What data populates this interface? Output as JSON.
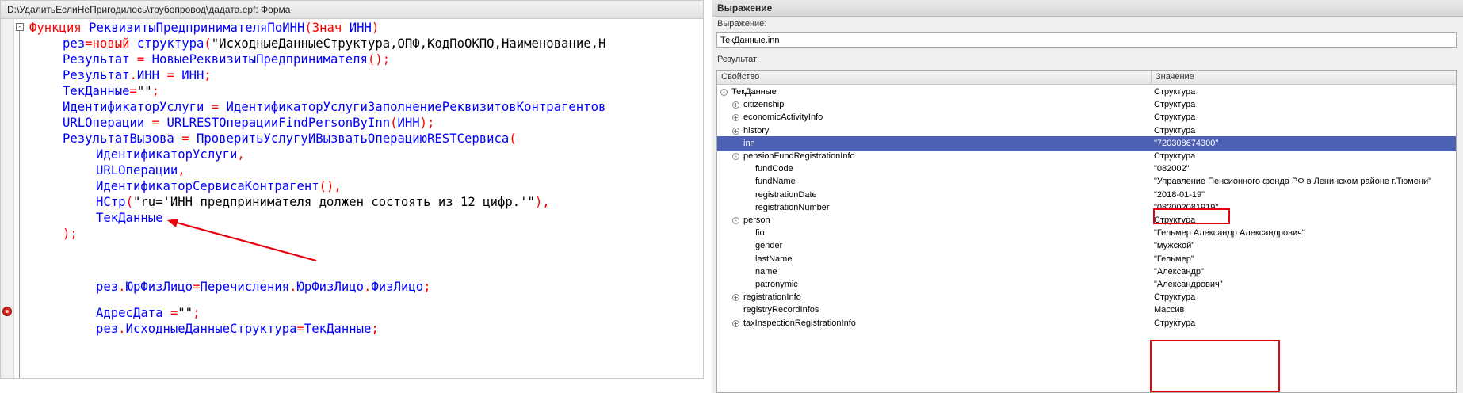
{
  "editor": {
    "title": "D:\\УдалитьЕслиНеПригодилось\\трубопровод\\дадата.epf: Форма",
    "fold_glyph": "-",
    "lines": [
      [
        [
          "kw",
          "Функция "
        ],
        [
          "id",
          "РеквизитыПредпринимателяПоИНН"
        ],
        [
          "op",
          "("
        ],
        [
          "kw",
          "Знач "
        ],
        [
          "id",
          "ИНН"
        ],
        [
          "op",
          ")"
        ]
      ],
      [
        [
          "id",
          "рез"
        ],
        [
          "op",
          "="
        ],
        [
          "kw",
          "новый "
        ],
        [
          "id",
          "структура"
        ],
        [
          "op",
          "("
        ],
        [
          "str",
          "\"ИсходныеДанныеСтруктура,ОПФ,КодПоОКПО,Наименование,Н"
        ]
      ],
      [
        [
          "id",
          "Результат "
        ],
        [
          "op",
          "= "
        ],
        [
          "id",
          "НовыеРеквизитыПредпринимателя"
        ],
        [
          "op",
          "();"
        ]
      ],
      [
        [
          "id",
          "Результат"
        ],
        [
          "op",
          "."
        ],
        [
          "id",
          "ИНН "
        ],
        [
          "op",
          "= "
        ],
        [
          "id",
          "ИНН"
        ],
        [
          "op",
          ";"
        ]
      ],
      [
        [
          "id",
          "ТекДанные"
        ],
        [
          "op",
          "="
        ],
        [
          "str",
          "\"\""
        ],
        [
          "op",
          ";"
        ]
      ],
      [
        [
          "id",
          "ИдентификаторУслуги "
        ],
        [
          "op",
          "= "
        ],
        [
          "id",
          "ИдентификаторУслугиЗаполнениеРеквизитовКонтрагентов"
        ]
      ],
      [
        [
          "id",
          "URLОперации "
        ],
        [
          "op",
          "= "
        ],
        [
          "id",
          "URLRESTОперацииFindPersonByInn"
        ],
        [
          "op",
          "("
        ],
        [
          "id",
          "ИНН"
        ],
        [
          "op",
          ");"
        ]
      ],
      [
        [
          "id",
          "РезультатВызова "
        ],
        [
          "op",
          "= "
        ],
        [
          "id",
          "ПроверитьУслугуИВызватьОперациюRESTСервиса"
        ],
        [
          "op",
          "("
        ]
      ],
      [
        [
          "id",
          "ИдентификаторУслуги"
        ],
        [
          "op",
          ","
        ]
      ],
      [
        [
          "id",
          "URLОперации"
        ],
        [
          "op",
          ","
        ]
      ],
      [
        [
          "id",
          "ИдентификаторСервисаКонтрагент"
        ],
        [
          "op",
          "(),"
        ]
      ],
      [
        [
          "id",
          "НСтр"
        ],
        [
          "op",
          "("
        ],
        [
          "str",
          "\"ru='ИНН предпринимателя должен состоять из 12 цифр.'\""
        ],
        [
          "op",
          "),"
        ]
      ],
      [
        [
          "id",
          "ТекДанные"
        ]
      ],
      [
        [
          "op",
          ");"
        ]
      ],
      [
        [
          "id",
          "рез"
        ],
        [
          "op",
          "."
        ],
        [
          "id",
          "ЮрФизЛицо"
        ],
        [
          "op",
          "="
        ],
        [
          "id",
          "Перечисления"
        ],
        [
          "op",
          "."
        ],
        [
          "id",
          "ЮрФизЛицо"
        ],
        [
          "op",
          "."
        ],
        [
          "id",
          "ФизЛицо"
        ],
        [
          "op",
          ";"
        ]
      ],
      [
        [
          "id",
          "АдресДата "
        ],
        [
          "op",
          "="
        ],
        [
          "str",
          "\"\""
        ],
        [
          "op",
          ";"
        ]
      ],
      [
        [
          "id",
          "рез"
        ],
        [
          "op",
          "."
        ],
        [
          "id",
          "ИсходныеДанныеСтруктура"
        ],
        [
          "op",
          "="
        ],
        [
          "id",
          "ТекДанные"
        ],
        [
          "op",
          ";"
        ]
      ]
    ]
  },
  "expression_window": {
    "title": "Выражение",
    "expression_label": "Выражение:",
    "expression_value": "ТекДанные.inn",
    "result_label": "Результат:",
    "columns": {
      "property": "Свойство",
      "value": "Значение"
    },
    "rows": [
      {
        "name": "ТекДанные",
        "value": "Структура",
        "toggle": "-"
      },
      {
        "name": "citizenship",
        "value": "Структура",
        "toggle": "+"
      },
      {
        "name": "economicActivityInfo",
        "value": "Структура",
        "toggle": "+"
      },
      {
        "name": "history",
        "value": "Структура",
        "toggle": "+"
      },
      {
        "name": "inn",
        "value": "\"720308674300\"",
        "toggle": "",
        "selected": true
      },
      {
        "name": "pensionFundRegistrationInfo",
        "value": "Структура",
        "toggle": "-"
      },
      {
        "name": "fundCode",
        "value": "\"082002\"",
        "toggle": ""
      },
      {
        "name": "fundName",
        "value": "\"Управление Пенсионного фонда РФ в Ленинском районе г.Тюмени\"",
        "toggle": ""
      },
      {
        "name": "registrationDate",
        "value": "\"2018-01-19\"",
        "toggle": ""
      },
      {
        "name": "registrationNumber",
        "value": "\"082002081919\"",
        "toggle": ""
      },
      {
        "name": "person",
        "value": "Структура",
        "toggle": "-"
      },
      {
        "name": "fio",
        "value": "\"Гельмер Александр Александрович\"",
        "toggle": ""
      },
      {
        "name": "gender",
        "value": "\"мужской\"",
        "toggle": ""
      },
      {
        "name": "lastName",
        "value": "\"Гельмер\"",
        "toggle": ""
      },
      {
        "name": "name",
        "value": "\"Александр\"",
        "toggle": ""
      },
      {
        "name": "patronymic",
        "value": "\"Александрович\"",
        "toggle": ""
      },
      {
        "name": "registrationInfo",
        "value": "Структура",
        "toggle": "+"
      },
      {
        "name": "registryRecordInfos",
        "value": "Массив",
        "toggle": ""
      },
      {
        "name": "taxInspectionRegistrationInfo",
        "value": "Структура",
        "toggle": "+"
      }
    ]
  },
  "colors": {
    "keyword": "#ff0000",
    "identifier": "#0000ff",
    "selection": "#4d61b4",
    "annotation": "#e8000b"
  }
}
